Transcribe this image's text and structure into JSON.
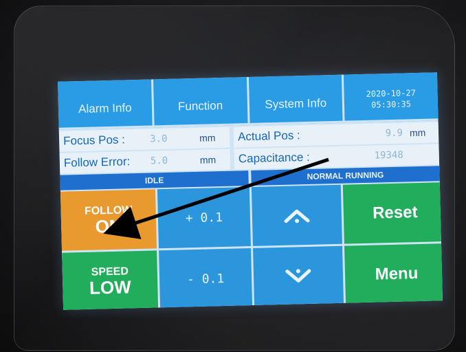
{
  "tabs": {
    "alarm": "Alarm Info",
    "function": "Function",
    "system": "System Info",
    "date": "2020-10-27",
    "time": "05:30:35"
  },
  "focus_pos": {
    "label": "Focus Pos :",
    "value": "3.0",
    "unit": "mm"
  },
  "actual_pos": {
    "label": "Actual Pos :",
    "value": "9.9",
    "unit": "mm"
  },
  "follow_error": {
    "label": "Follow Error:",
    "value": "5.0",
    "unit": "mm"
  },
  "capacitance": {
    "label": "Capacitance :",
    "value": "19348"
  },
  "status": {
    "left": "IDLE",
    "right": "NORMAL RUNNING"
  },
  "controls": {
    "follow_top": "FOLLOW",
    "follow_bottom": "ON",
    "plus_step": "+ 0.1",
    "minus_step": "- 0.1",
    "reset": "Reset",
    "menu": "Menu",
    "speed_top": "SPEED",
    "speed_bottom": "LOW"
  },
  "icons": {
    "up": "chevron-up-icon",
    "down": "chevron-down-icon"
  },
  "colors": {
    "orange": "#e89a2e",
    "green": "#22ad5c",
    "blue": "#2b96dc",
    "status_blue": "#1f6fcf",
    "annotation": "#000000"
  }
}
